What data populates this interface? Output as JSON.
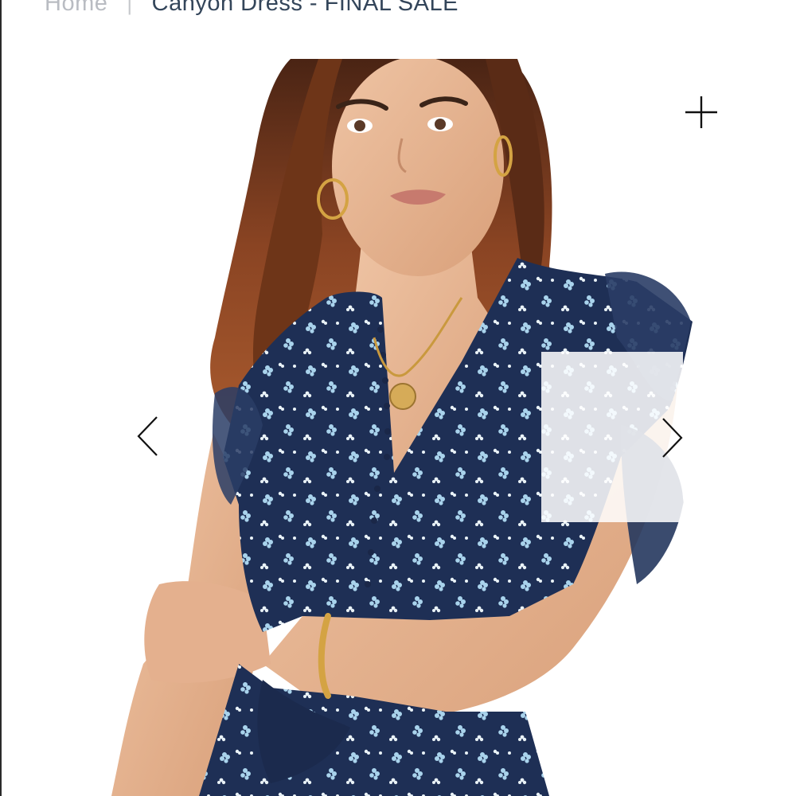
{
  "breadcrumb": {
    "home": "Home",
    "separator": "|",
    "current": "Canyon Dress - FINAL SALE"
  },
  "gallery": {
    "prev_icon": "chevron-left-icon",
    "next_icon": "chevron-right-icon",
    "zoom_icon": "plus-icon"
  },
  "colors": {
    "dress_navy": "#1e2f55",
    "flower_blue": "#a9d3ec",
    "hair_brown": "#7a3e22",
    "skin": "#e8b898",
    "crumb_text": "#33455a"
  }
}
